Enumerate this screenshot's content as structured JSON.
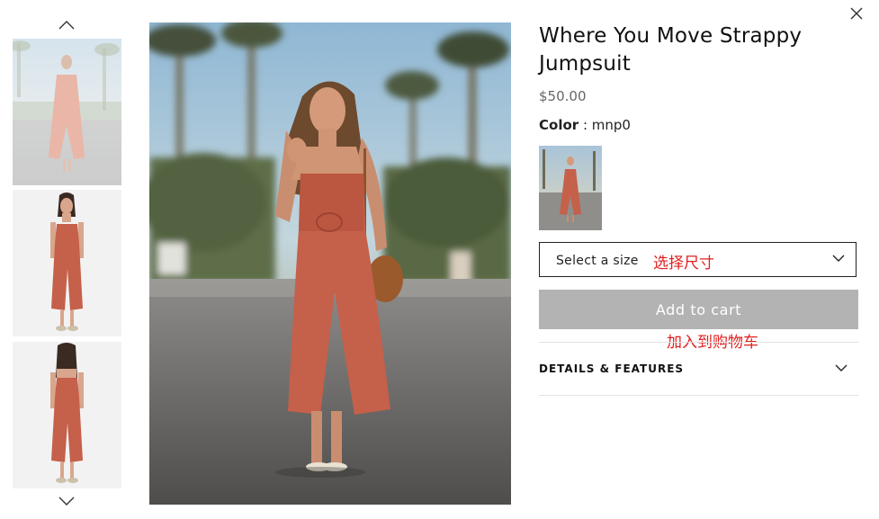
{
  "product": {
    "title": "Where You Move Strappy Jumpsuit",
    "price": "$50.00",
    "color_label": "Color",
    "color_separator": ":",
    "color_value": "mnp0"
  },
  "size_select": {
    "placeholder": "Select a size",
    "annotation": "选择尺寸"
  },
  "add_to_cart": {
    "label": "Add to cart",
    "annotation": "加入到购物车"
  },
  "details": {
    "label": "DETAILS & FEATURES"
  },
  "icons": {
    "thumbs_up": "chevron-up-icon",
    "thumbs_down": "chevron-down-icon",
    "close": "close-icon",
    "select_chevron": "chevron-down-icon",
    "details_chevron": "chevron-down-icon"
  },
  "colors": {
    "dress": "#c5604a",
    "button_disabled": "#b3b3b3",
    "annotation": "#e02020"
  }
}
